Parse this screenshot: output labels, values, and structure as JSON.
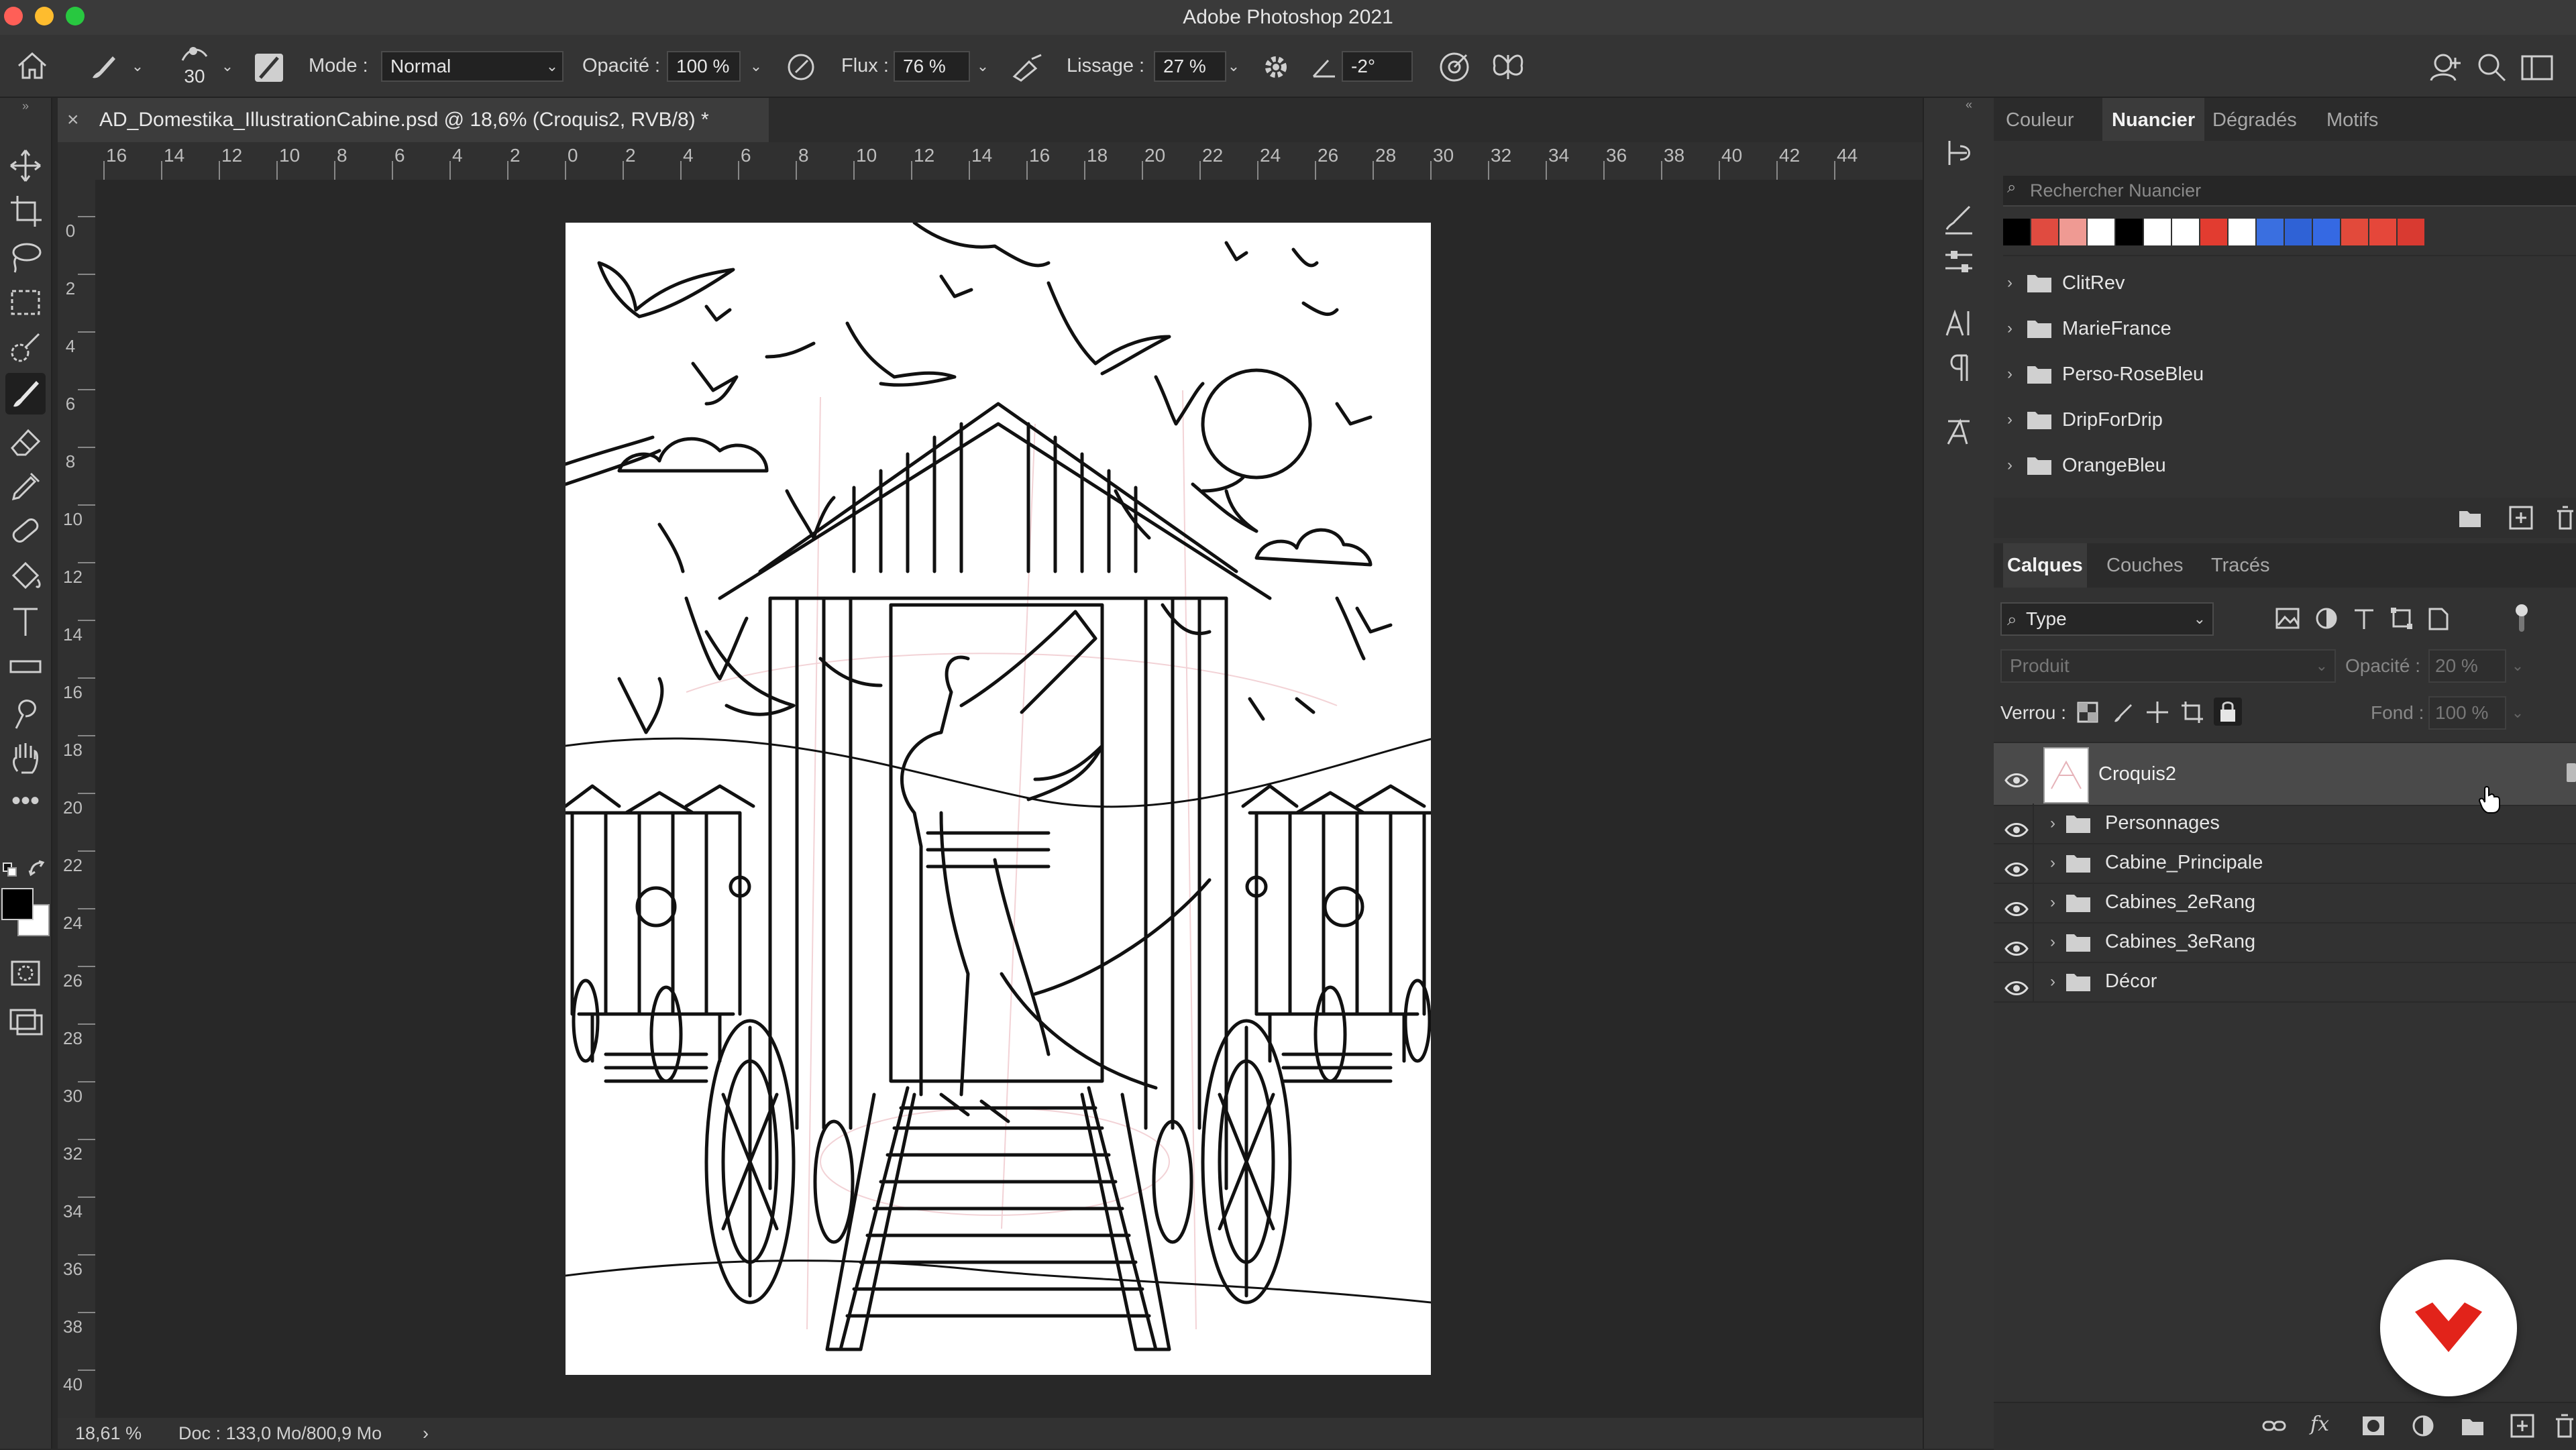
{
  "app": {
    "title": "Adobe Photoshop 2021"
  },
  "options_bar": {
    "brush_size": "30",
    "mode_label": "Mode :",
    "mode_value": "Normal",
    "opacity_label": "Opacité :",
    "opacity_value": "100 %",
    "flow_label": "Flux :",
    "flow_value": "76 %",
    "smoothing_label": "Lissage :",
    "smoothing_value": "27 %",
    "angle_value": "-2°"
  },
  "document": {
    "tab_title": "AD_Domestika_IllustrationCabine.psd @ 18,6% (Croquis2, RVB/8) *"
  },
  "ruler": {
    "top": [
      "16",
      "14",
      "12",
      "10",
      "8",
      "6",
      "4",
      "2",
      "0",
      "2",
      "4",
      "6",
      "8",
      "10",
      "12",
      "14",
      "16",
      "18",
      "20",
      "22",
      "24",
      "26",
      "28",
      "30",
      "32",
      "34",
      "36",
      "38",
      "40",
      "42",
      "44"
    ],
    "left": [
      "0",
      "2",
      "4",
      "6",
      "8",
      "10",
      "12",
      "14",
      "16",
      "18",
      "20",
      "22",
      "24",
      "26",
      "28",
      "30",
      "32",
      "34",
      "36",
      "38",
      "40"
    ]
  },
  "status": {
    "zoom": "18,61 %",
    "doc": "Doc : 133,0 Mo/800,9 Mo"
  },
  "swatches_panel": {
    "tabs": [
      "Couleur",
      "Nuancier",
      "Dégradés",
      "Motifs"
    ],
    "active_tab": "Nuancier",
    "search_placeholder": "Rechercher Nuancier",
    "colors": [
      "#000000",
      "#e04b40",
      "#ef9a93",
      "#ffffff",
      "#000000",
      "#ffffff",
      "#ffffff",
      "#e23c30",
      "#ffffff",
      "#3a6fe0",
      "#2f62d6",
      "#3569e3",
      "#e24a3b",
      "#e5473a",
      "#d93a31"
    ],
    "groups": [
      "ClitRev",
      "MarieFrance",
      "Perso-RoseBleu",
      "DripForDrip",
      "OrangeBleu"
    ]
  },
  "layers_panel": {
    "tabs": [
      "Calques",
      "Couches",
      "Tracés"
    ],
    "active_tab": "Calques",
    "filter_value": "Type",
    "blend_mode": "Produit",
    "opacity_label": "Opacité :",
    "opacity_value": "20 %",
    "lock_label": "Verrou :",
    "fill_label": "Fond :",
    "fill_value": "100 %",
    "layers": [
      {
        "name": "Croquis2",
        "type": "layer",
        "selected": true
      },
      {
        "name": "Personnages",
        "type": "group"
      },
      {
        "name": "Cabine_Principale",
        "type": "group"
      },
      {
        "name": "Cabines_2eRang",
        "type": "group"
      },
      {
        "name": "Cabines_3eRang",
        "type": "group"
      },
      {
        "name": "Décor",
        "type": "group"
      }
    ]
  },
  "accent": {
    "domestika_red": "#e2231a"
  }
}
